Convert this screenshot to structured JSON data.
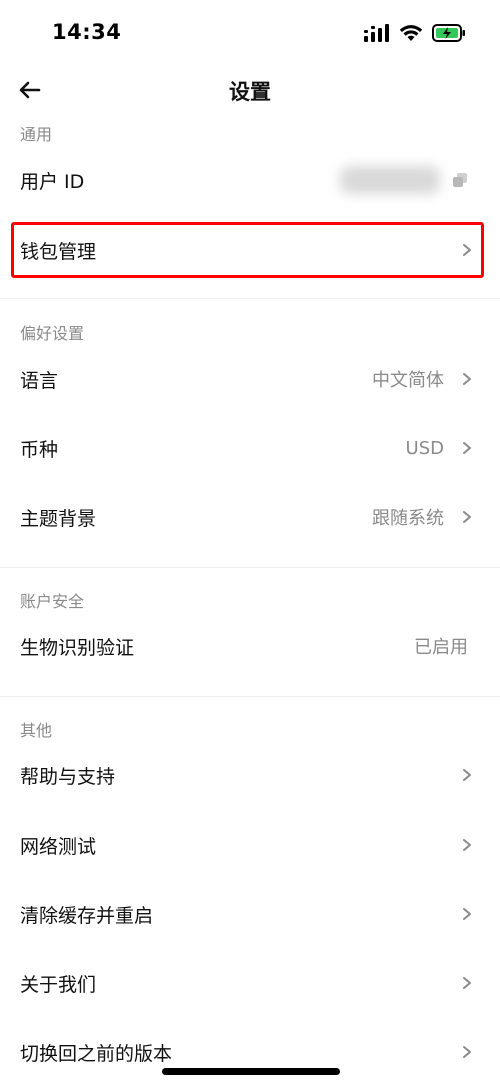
{
  "status_bar": {
    "time": "14:34",
    "icons": [
      "cellular-signal-icon",
      "wifi-icon",
      "battery-charging-icon"
    ],
    "battery_color": "#34c759"
  },
  "nav": {
    "title": "设置",
    "back_icon": "arrow-left-icon"
  },
  "sections": {
    "general": {
      "title": "通用",
      "user_id_label": "用户 ID",
      "wallet_label": "钱包管理"
    },
    "preferences": {
      "title": "偏好设置",
      "language_label": "语言",
      "language_value": "中文简体",
      "currency_label": "币种",
      "currency_value": "USD",
      "theme_label": "主题背景",
      "theme_value": "跟随系统"
    },
    "security": {
      "title": "账户安全",
      "biometric_label": "生物识别验证",
      "biometric_value": "已启用"
    },
    "other": {
      "title": "其他",
      "help_label": "帮助与支持",
      "network_label": "网络测试",
      "clear_cache_label": "清除缓存并重启",
      "about_label": "关于我们",
      "switch_version_label": "切换回之前的版本"
    }
  },
  "colors": {
    "highlight": "#ff0000",
    "secondary_text": "#8a8a8a",
    "divider": "#efefef"
  }
}
